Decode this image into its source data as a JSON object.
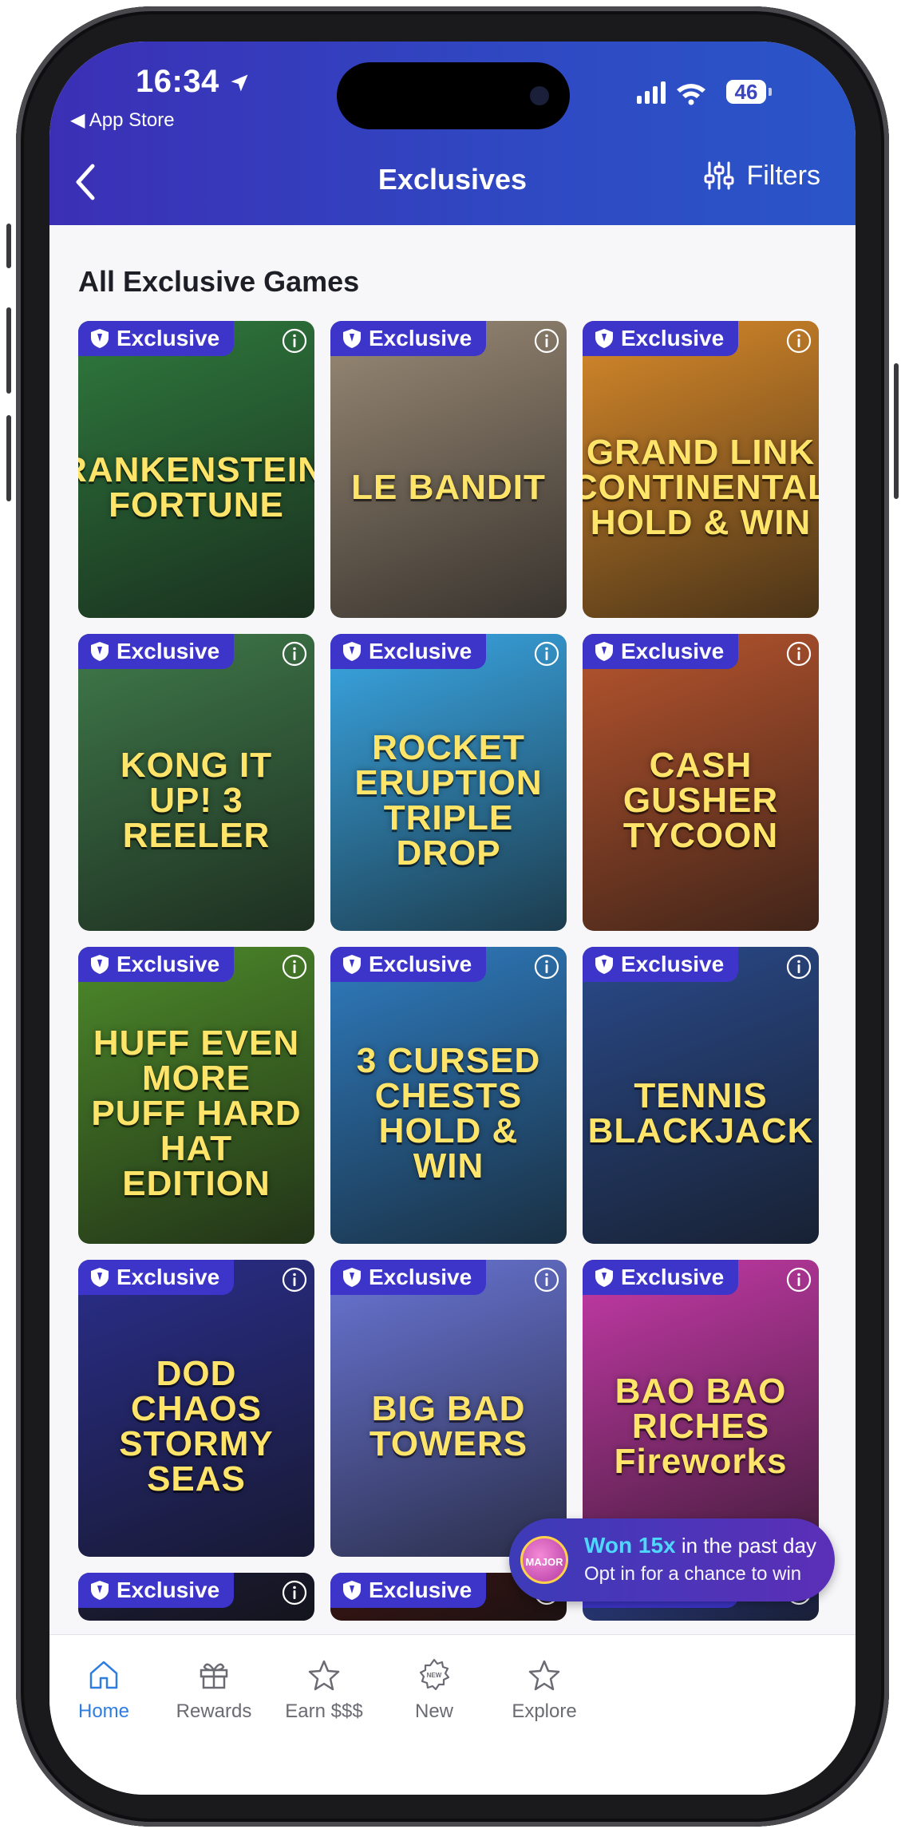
{
  "status": {
    "time": "16:34",
    "back_label": "◀ App Store",
    "battery": "46"
  },
  "nav": {
    "title": "Exclusives",
    "filters_label": "Filters"
  },
  "section": {
    "title": "All Exclusive Games"
  },
  "badge_label": "Exclusive",
  "games": [
    {
      "name": "FRANKENSTEIN's FORTUNE",
      "color": "#2f7a3e"
    },
    {
      "name": "LE BANDIT",
      "color": "#9a8a76"
    },
    {
      "name": "GRAND LINK CONTINENTAL HOLD & WIN",
      "color": "#d98a2a"
    },
    {
      "name": "KONG IT UP! 3 REELER",
      "color": "#3f7a4a"
    },
    {
      "name": "ROCKET ERUPTION TRIPLE DROP",
      "color": "#3aa8e6"
    },
    {
      "name": "CASH GUSHER TYCOON",
      "color": "#b8552e"
    },
    {
      "name": "HUFF EVEN MORE PUFF HARD HAT EDITION",
      "color": "#4d8a2a"
    },
    {
      "name": "3 CURSED CHESTS HOLD & WIN",
      "color": "#2f7cc0"
    },
    {
      "name": "TENNIS BLACKJACK",
      "color": "#2a4a8a"
    },
    {
      "name": "DOD CHAOS STORMY SEAS",
      "color": "#2a2e8a"
    },
    {
      "name": "BIG BAD TOWERS",
      "color": "#6a76d6"
    },
    {
      "name": "BAO BAO RICHES Fireworks",
      "color": "#c53aa8"
    },
    {
      "name": "",
      "color": "#1c1c3a"
    },
    {
      "name": "",
      "color": "#3a1414"
    },
    {
      "name": "",
      "color": "#2c3f8a"
    }
  ],
  "toast": {
    "highlight": "Won 15x",
    "line1_rest": " in the past day",
    "line2": "Opt in for a chance to win",
    "icon_label": "MAJOR"
  },
  "tabs": [
    {
      "label": "Home",
      "active": true
    },
    {
      "label": "Rewards"
    },
    {
      "label": "Earn $$$"
    },
    {
      "label": "New"
    },
    {
      "label": "Explore"
    }
  ],
  "colors": {
    "header_start": "#3b2fb6",
    "header_end": "#2a55c8",
    "badge": "#3d35c9",
    "tab_active": "#2f7de1"
  }
}
